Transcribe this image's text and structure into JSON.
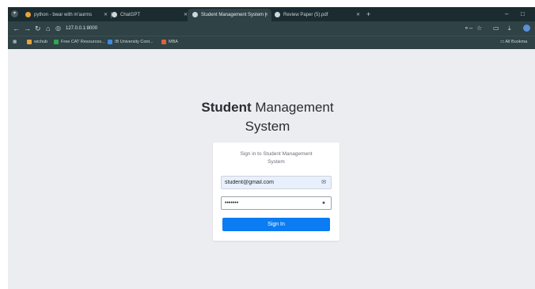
{
  "browser": {
    "tabs": [
      {
        "title": "python - bwar with m'aurms",
        "favicon_color": "#e8a33d"
      },
      {
        "title": "ChatGPT",
        "favicon_color": "#cfd6d8"
      },
      {
        "title": "Student Management System |",
        "favicon_color": "#cfd6d8"
      },
      {
        "title": "Review Paper (5).pdf",
        "favicon_color": "#cfd6d8"
      }
    ],
    "url": "127.0.0.1:8000",
    "bookmarks": [
      {
        "label": "wichub",
        "icon_color": "#e8a33d"
      },
      {
        "label": "Free CAT Resources...",
        "icon_color": "#2fa84f"
      },
      {
        "label": "IB University Cont...",
        "icon_color": "#3d8be8"
      },
      {
        "label": "MBA",
        "icon_color": "#e0603d"
      }
    ],
    "all_bookmarks_label": "All Bookma"
  },
  "page": {
    "title_bold": "Student",
    "title_rest_line1": " Management",
    "title_line2": "System"
  },
  "login": {
    "subtitle_line1": "Sign in to Student Management",
    "subtitle_line2": "System",
    "email_value": "student@gmail.com",
    "password_value": "•••••••",
    "signin_label": "Sign In"
  },
  "colors": {
    "accent": "#0b7cf2",
    "chrome": "#2f4246",
    "page_bg": "#ecedf1"
  }
}
